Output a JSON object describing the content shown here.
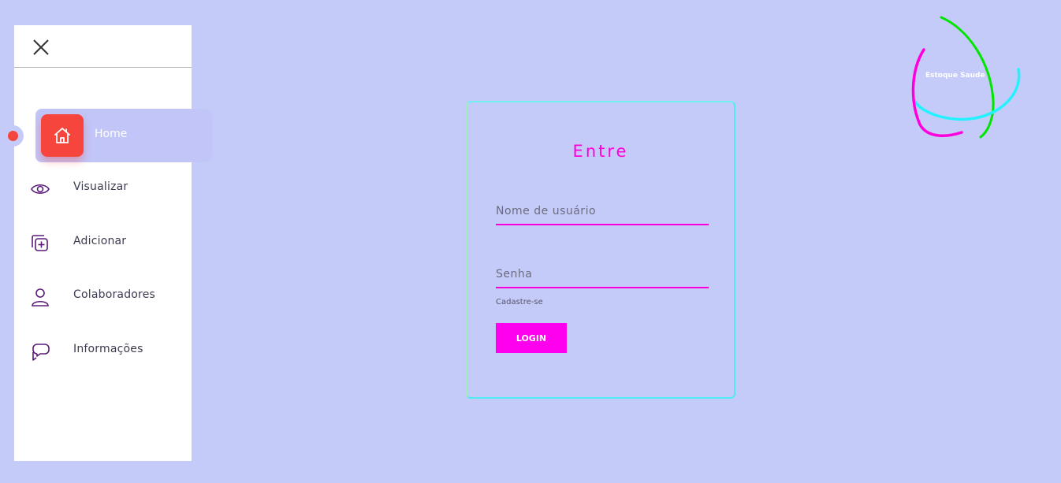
{
  "sidebar": {
    "close_icon": "close-icon",
    "items": [
      {
        "label": "Home",
        "icon": "home-icon",
        "active": true
      },
      {
        "label": "Visualizar",
        "icon": "eye-icon"
      },
      {
        "label": "Adicionar",
        "icon": "add-square-icon"
      },
      {
        "label": "Colaboradores",
        "icon": "user-icon"
      },
      {
        "label": "Informações",
        "icon": "chat-icon"
      }
    ]
  },
  "login": {
    "title": "Entre",
    "username_placeholder": "Nome de usuário",
    "password_placeholder": "Senha",
    "signup_label": "Cadastre-se",
    "login_button": "LOGIN"
  },
  "logo": {
    "text": "Estoque Saude"
  },
  "colors": {
    "background": "#c5cbf8",
    "accent": "#ff00dd",
    "active": "#f5453c",
    "cyan": "#52eaf2",
    "green": "#00e600"
  }
}
